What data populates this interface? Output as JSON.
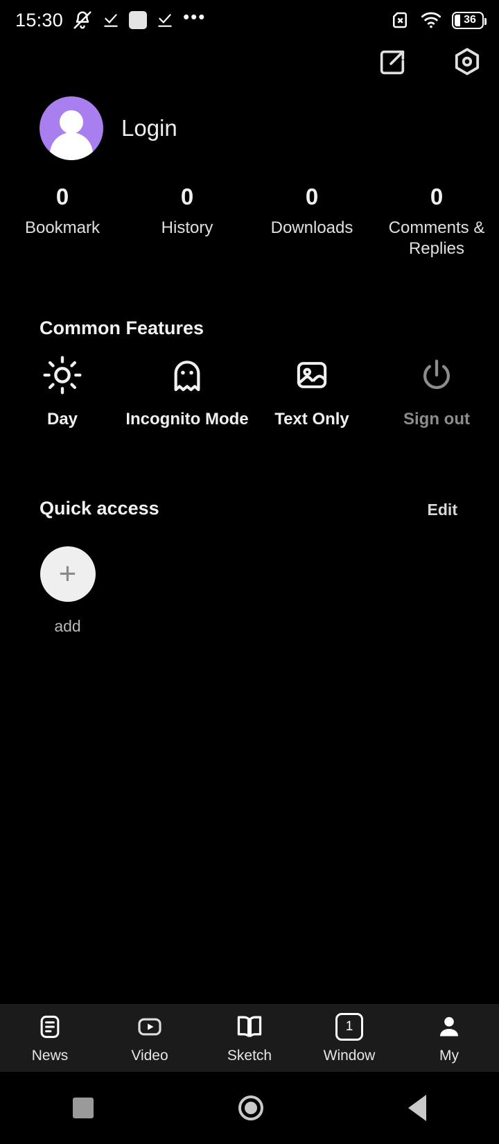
{
  "statusbar": {
    "time": "15:30",
    "battery_level": "36",
    "icons": [
      "bell-muted-icon",
      "check-underline-icon",
      "white-square-icon",
      "check-underline-icon",
      "ellipsis-icon"
    ],
    "right_icons": [
      "sim-card-x-icon",
      "wifi-icon",
      "battery-icon"
    ]
  },
  "toolbar": {
    "share_label": "share-icon",
    "settings_label": "hexagon-settings-icon"
  },
  "account": {
    "login_label": "Login",
    "avatar_color": "#a97ff0"
  },
  "stats": [
    {
      "value": "0",
      "label": "Bookmark"
    },
    {
      "value": "0",
      "label": "History"
    },
    {
      "value": "0",
      "label": "Downloads"
    },
    {
      "value": "0",
      "label": "Comments & Replies"
    }
  ],
  "common_features": {
    "title": "Common Features",
    "items": [
      {
        "label": "Day",
        "icon": "sun-icon",
        "disabled": false
      },
      {
        "label": "Incognito Mode",
        "icon": "ghost-icon",
        "disabled": false
      },
      {
        "label": "Text Only",
        "icon": "image-icon",
        "disabled": false
      },
      {
        "label": "Sign out",
        "icon": "power-icon",
        "disabled": true
      }
    ]
  },
  "quick_access": {
    "title": "Quick access",
    "edit_label": "Edit",
    "items": [
      {
        "label": "add",
        "icon": "plus-icon"
      }
    ]
  },
  "bottom_nav": {
    "items": [
      {
        "label": "News",
        "icon": "document-icon",
        "active": false
      },
      {
        "label": "Video",
        "icon": "play-square-icon",
        "active": false
      },
      {
        "label": "Sketch",
        "icon": "open-book-icon",
        "active": false
      },
      {
        "label": "Window",
        "icon": "window-count-icon",
        "badge": "1",
        "active": false
      },
      {
        "label": "My",
        "icon": "person-icon",
        "active": true
      }
    ]
  },
  "system_nav": {
    "recents": "recents-square-icon",
    "home": "home-circle-icon",
    "back": "back-triangle-icon"
  }
}
